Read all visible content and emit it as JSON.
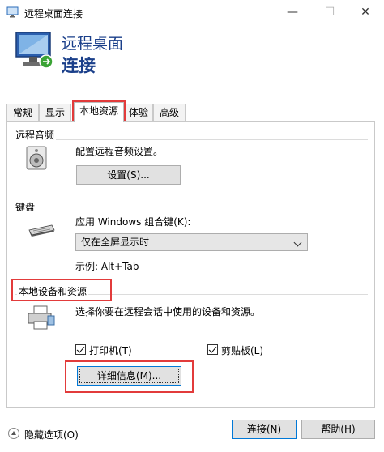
{
  "window": {
    "title": "远程桌面连接",
    "min_glyph": "—",
    "max_glyph": "☐",
    "close_glyph": "✕"
  },
  "header": {
    "line1": "远程桌面",
    "line2": "连接"
  },
  "tabs": [
    {
      "label": "常规"
    },
    {
      "label": "显示"
    },
    {
      "label": "本地资源",
      "active": true
    },
    {
      "label": "体验"
    },
    {
      "label": "高级"
    }
  ],
  "audio": {
    "group_label": "远程音频",
    "description": "配置远程音频设置。",
    "settings_button": "设置(S)..."
  },
  "keyboard": {
    "group_label": "键盘",
    "apply_label": "应用 Windows 组合键(K):",
    "selected_option": "仅在全屏显示时",
    "example": "示例: Alt+Tab"
  },
  "devices": {
    "group_label": "本地设备和资源",
    "description": "选择你要在远程会话中使用的设备和资源。",
    "printer_label": "打印机(T)",
    "printer_checked": true,
    "clipboard_label": "剪贴板(L)",
    "clipboard_checked": true,
    "more_button": "详细信息(M)..."
  },
  "footer": {
    "hide_options": "隐藏选项(O)",
    "connect_button": "连接(N)",
    "help_button": "帮助(H)"
  },
  "colors": {
    "accent": "#0078d7",
    "header_text": "#1a3f8a",
    "highlight_box": "#e23b3b"
  },
  "icons": [
    "remote-desktop-icon",
    "monitor-icon",
    "speaker-icon",
    "keyboard-icon",
    "printer-icon",
    "chevron-down-icon",
    "expand-icon"
  ]
}
